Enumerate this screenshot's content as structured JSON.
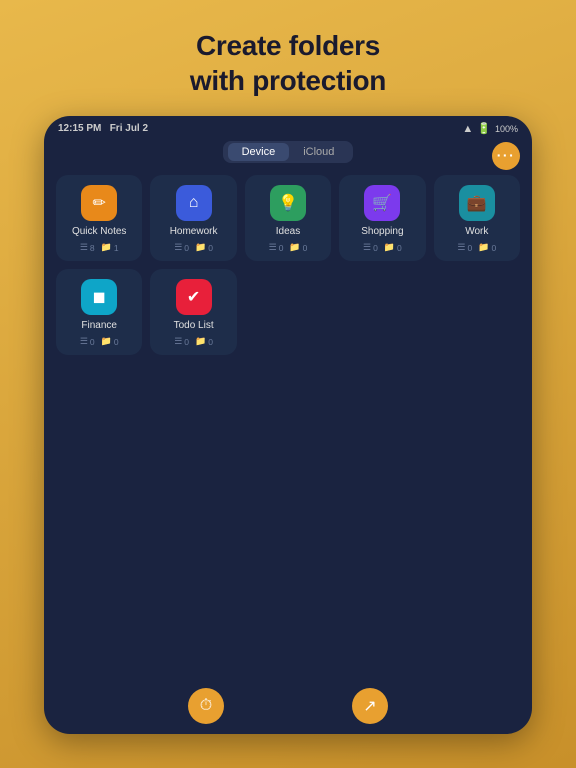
{
  "headline": {
    "line1": "Create folders",
    "line2": "with protection"
  },
  "status": {
    "time": "12:15 PM",
    "date": "Fri Jul 2",
    "wifi": "📶",
    "battery": "100%"
  },
  "tabs": [
    {
      "label": "Device",
      "active": true
    },
    {
      "label": "iCloud",
      "active": false
    }
  ],
  "more_button": "•••",
  "folders": [
    {
      "name": "Quick Notes",
      "icon": "✏️",
      "icon_color": "icon-orange",
      "notes": "8",
      "folders": "1"
    },
    {
      "name": "Homework",
      "icon": "🏠",
      "icon_color": "icon-blue",
      "notes": "0",
      "folders": "0"
    },
    {
      "name": "Ideas",
      "icon": "💡",
      "icon_color": "icon-green",
      "notes": "0",
      "folders": "0"
    },
    {
      "name": "Shopping",
      "icon": "🛒",
      "icon_color": "icon-purple",
      "notes": "0",
      "folders": "0"
    },
    {
      "name": "Work",
      "icon": "💼",
      "icon_color": "icon-teal",
      "notes": "0",
      "folders": "0"
    },
    {
      "name": "Finance",
      "icon": "💳",
      "icon_color": "icon-cyan",
      "notes": "0",
      "folders": "0"
    },
    {
      "name": "Todo List",
      "icon": "✅",
      "icon_color": "icon-red",
      "notes": "0",
      "folders": "0"
    }
  ],
  "bottom_buttons": [
    {
      "name": "clock-button",
      "icon": "🕐"
    },
    {
      "name": "sync-button",
      "icon": "↗"
    }
  ]
}
